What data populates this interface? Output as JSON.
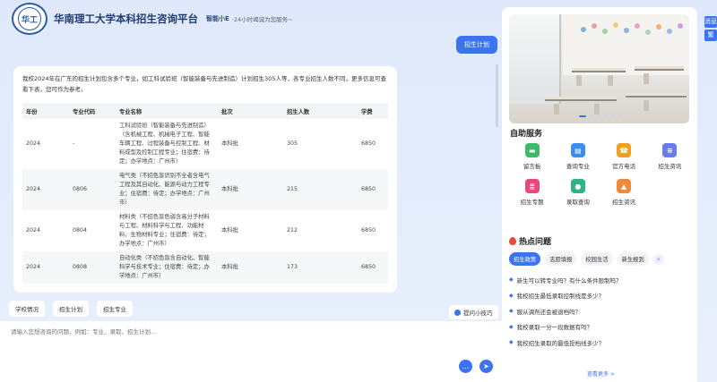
{
  "header": {
    "logo_text": "华工",
    "title": "华南理工大学本科招生咨询平台",
    "assistant_name": "智能小E",
    "slogan": "·24小时竭诚为您服务~"
  },
  "chat": {
    "user_message": "招生计划",
    "intro": "我校2024年在广东的招生计划包含多个专业，如工科试验班（智能装备与先进制造）计划招生305人等，各专业招生人数不同，更多信息可查看下表，您可作为参考。",
    "table": {
      "headers": [
        "年份",
        "专业代码",
        "专业名称",
        "批次",
        "招生人数",
        "学费"
      ],
      "rows": [
        [
          "2024",
          "-",
          "工科试验班（智能装备与先进制造）（含机械工程、机械电子工程、智能车辆工程、过程装备与控制工程、材料成型及控制工程专业；住宿费：待定；办学地点：广州市）",
          "本科批",
          "305",
          "6850"
        ],
        [
          "2024",
          "0806",
          "电气类（不招色盲识别不全者含电气工程及其自动化、能源与动力工程专业；住宿费：待定；办学地点：广州市）",
          "本科批",
          "215",
          "6850"
        ],
        [
          "2024",
          "0804",
          "材料类（不招色盲色弱含高分子材料与工程、材料科学与工程、功能材料、生物材料专业；住宿费：待定；办学地点：广州市）",
          "本科批",
          "212",
          "6850"
        ],
        [
          "2024",
          "0808",
          "自动化类（不招色盲含自动化、智能科学与技术专业；住宿费：待定；办学地点：广州市）",
          "本科批",
          "173",
          "6850"
        ]
      ]
    }
  },
  "quick_actions": [
    "学校情况",
    "招生计划",
    "招生专业"
  ],
  "tips_label": "提问小技巧",
  "input": {
    "placeholder": "请输入您想咨询的问题，例如：专业、录取、招生计划..."
  },
  "self_service": {
    "title": "自助服务",
    "items": [
      {
        "label": "留言板",
        "icon": "message-board-icon",
        "color": "#3cb96b"
      },
      {
        "label": "查询专业",
        "icon": "major-query-icon",
        "color": "#3b8df0"
      },
      {
        "label": "官方电话",
        "icon": "phone-icon",
        "color": "#f0a020"
      },
      {
        "label": "招生资讯",
        "icon": "news-icon",
        "color": "#6a7cf0"
      },
      {
        "label": "招生专题",
        "icon": "topic-icon",
        "color": "#e8487a"
      },
      {
        "label": "录取查询",
        "icon": "admission-query-icon",
        "color": "#2fb38a"
      },
      {
        "label": "招生资讯",
        "icon": "graduation-icon",
        "color": "#f08a3b"
      }
    ]
  },
  "hot": {
    "title": "热点问题",
    "tabs": [
      "招生政策",
      "志愿填报",
      "校园生活",
      "新生报到"
    ],
    "questions": [
      "新生可以转专业吗？有什么条件限制吗？",
      "我校招生最低录取控制线是多少？",
      "服从调剂还会被退档吗？",
      "我校录取一分一段数据有吗？",
      "我校招生录取的最低投档线多少？"
    ],
    "view_more": "查看更多 >"
  },
  "side_buttons": [
    "消息",
    "繁"
  ]
}
